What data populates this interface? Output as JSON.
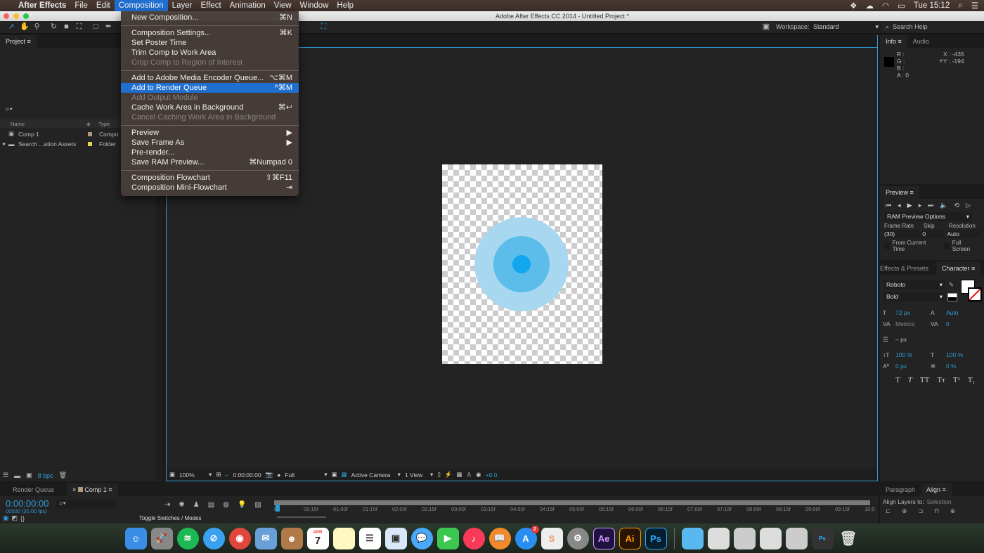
{
  "menubar": {
    "app": "After Effects",
    "items": [
      "File",
      "Edit",
      "Composition",
      "Layer",
      "Effect",
      "Animation",
      "View",
      "Window",
      "Help"
    ],
    "clock": "Tue 15:12"
  },
  "window": {
    "title": "Adobe After Effects CC 2014 - Untitled Project *"
  },
  "toolbar": {
    "workspace_label": "Workspace:",
    "workspace_value": "Standard",
    "search_help": "Search Help"
  },
  "composition_menu": {
    "groups": [
      [
        {
          "label": "New Composition...",
          "shortcut": "⌘N",
          "enabled": true
        }
      ],
      [
        {
          "label": "Composition Settings...",
          "shortcut": "⌘K",
          "enabled": true
        },
        {
          "label": "Set Poster Time",
          "shortcut": "",
          "enabled": true
        },
        {
          "label": "Trim Comp to Work Area",
          "shortcut": "",
          "enabled": true
        },
        {
          "label": "Crop Comp to Region of Interest",
          "shortcut": "",
          "enabled": false
        }
      ],
      [
        {
          "label": "Add to Adobe Media Encoder Queue...",
          "shortcut": "⌥⌘M",
          "enabled": true
        },
        {
          "label": "Add to Render Queue",
          "shortcut": "^⌘M",
          "enabled": true,
          "highlighted": true
        },
        {
          "label": "Add Output Module",
          "shortcut": "",
          "enabled": false
        },
        {
          "label": "Cache Work Area in Background",
          "shortcut": "⌘↩",
          "enabled": true
        },
        {
          "label": "Cancel Caching Work Area in Background",
          "shortcut": "",
          "enabled": false
        }
      ],
      [
        {
          "label": "Preview",
          "shortcut": "▶",
          "enabled": true
        },
        {
          "label": "Save Frame As",
          "shortcut": "▶",
          "enabled": true
        },
        {
          "label": "Pre-render...",
          "shortcut": "",
          "enabled": true
        },
        {
          "label": "Save RAM Preview...",
          "shortcut": "⌘Numpad 0",
          "enabled": true
        }
      ],
      [
        {
          "label": "Composition Flowchart",
          "shortcut": "⇧⌘F11",
          "enabled": true
        },
        {
          "label": "Composition Mini-Flowchart",
          "shortcut": "⇥",
          "enabled": true
        }
      ]
    ]
  },
  "project": {
    "tab": "Project",
    "columns": {
      "name": "Name",
      "type": "Type"
    },
    "items": [
      {
        "name": "Comp 1",
        "type": "Compo",
        "color": "#b09880"
      },
      {
        "name": "Search ...ation Assets",
        "type": "Folder",
        "color": "#e8d44a"
      }
    ],
    "bpc": "8 bpc"
  },
  "viewer": {
    "zoom": "100%",
    "timecode": "0:00:00:00",
    "resolution": "Full",
    "camera": "Active Camera",
    "views": "1 View",
    "exposure": "+0.0"
  },
  "info": {
    "tabs": [
      "Info",
      "Audio"
    ],
    "r": "R :",
    "g": "G :",
    "b": "B :",
    "a": "A : 0",
    "x": "X : -435",
    "y": "Y : -194"
  },
  "preview": {
    "tab": "Preview",
    "ram_options": "RAM Preview Options",
    "frame_rate_label": "Frame Rate",
    "frame_rate": "(30)",
    "skip_label": "Skip",
    "skip": "0",
    "resolution_label": "Resolution",
    "resolution": "Auto",
    "from_current": "From Current Time",
    "full_screen": "Full Screen"
  },
  "character": {
    "tabs": [
      "Effects & Presets",
      "Character"
    ],
    "font": "Roboto",
    "style": "Bold",
    "size": "72 px",
    "leading": "Auto",
    "kerning": "Metrics",
    "tracking": "0",
    "stroke": "– px",
    "vscale": "100 %",
    "hscale": "100 %",
    "baseline": "0 px",
    "tsume": "0 %",
    "styles": [
      "T",
      "T",
      "TT",
      "Tт",
      "T¹",
      "T₁"
    ]
  },
  "timeline": {
    "tabs": [
      "Render Queue",
      "Comp 1"
    ],
    "timecode": "0:00:00:00",
    "frames": "00000 (30.00 fps)",
    "toggle": "Toggle Switches / Modes",
    "ticks": [
      "0f",
      "00:15f",
      "01:00f",
      "01:15f",
      "02:00f",
      "02:15f",
      "03:00f",
      "03:15f",
      "04:00f",
      "04:15f",
      "05:00f",
      "05:15f",
      "06:00f",
      "06:15f",
      "07:00f",
      "07:15f",
      "08:00f",
      "08:15f",
      "09:00f",
      "09:15f",
      "10:0"
    ]
  },
  "align": {
    "tabs": [
      "Paragraph",
      "Align"
    ],
    "align_to_label": "Align Layers to:",
    "align_to": "Selection"
  },
  "colors": {
    "accent": "#2d9bd6",
    "menu_highlight": "#1f6fd1",
    "circle_outer": "#a8d8f0",
    "circle_mid": "#5cbdea",
    "circle_inner": "#12a6ef"
  },
  "dock": {
    "badge": "2",
    "apps": [
      "finder",
      "launchpad",
      "spotify",
      "safari",
      "chrome",
      "mail",
      "contacts",
      "calendar",
      "notes",
      "reminders",
      "preview",
      "messages",
      "facetime",
      "music",
      "books",
      "app-store",
      "sublime",
      "system-preferences",
      "Ae",
      "Ai",
      "Ps",
      "folder",
      "trash"
    ],
    "calendar_day": "7",
    "calendar_month": "APR"
  }
}
